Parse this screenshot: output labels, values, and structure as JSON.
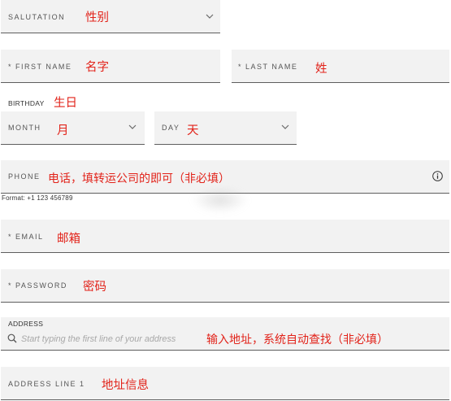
{
  "colors": {
    "annotation": "#e2231a",
    "field_background": "#f2f2f2",
    "field_border": "#5e5e5e",
    "label": "#555555",
    "placeholder": "#a8a8a8"
  },
  "icons": {
    "dropdown": "chevron-down-icon",
    "phone_info": "info-icon",
    "address_search": "search-icon"
  },
  "form": {
    "salutation": {
      "label": "SALUTATION",
      "annotation": "性别"
    },
    "first_name": {
      "label": "* FIRST NAME",
      "annotation": "名字"
    },
    "last_name": {
      "label": "* LAST NAME",
      "annotation": "姓"
    },
    "birthday": {
      "label": "BIRTHDAY",
      "annotation": "生日",
      "month": {
        "label": "MONTH",
        "annotation": "月"
      },
      "day": {
        "label": "DAY",
        "annotation": "天"
      }
    },
    "phone": {
      "label": "PHONE",
      "annotation": "电话，填转运公司的即可（非必填）",
      "format_hint": "Format: +1 123 456789"
    },
    "email": {
      "label": "* EMAIL",
      "annotation": "邮箱"
    },
    "password": {
      "label": "* PASSWORD",
      "annotation": "密码"
    },
    "address": {
      "label": "ADDRESS",
      "placeholder": "Start typing the first line of your address",
      "annotation": "输入地址，系统自动查找（非必填）"
    },
    "address_line_1": {
      "label": "ADDRESS LINE 1",
      "annotation": "地址信息"
    }
  }
}
